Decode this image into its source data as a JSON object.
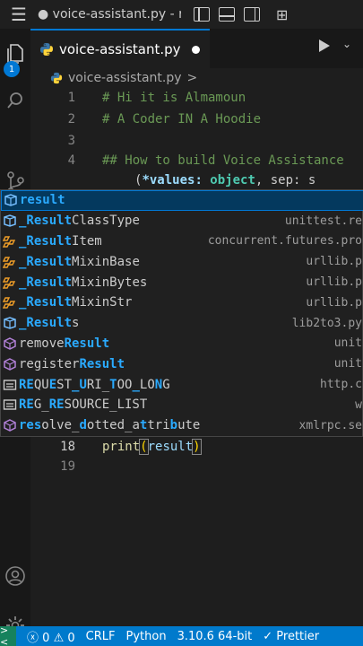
{
  "titlebar": {
    "title": "● voice-assistant.py - r"
  },
  "activity": {
    "explorer_badge": "1"
  },
  "tab": {
    "label": "voice-assistant.py"
  },
  "breadcrumb": {
    "file": "voice-assistant.py",
    "chevron": ">"
  },
  "editor": {
    "lines": [
      {
        "num": "1",
        "text": "# Hi it is Almamoun"
      },
      {
        "num": "2",
        "text": "# A Coder IN A Hoodie"
      },
      {
        "num": "3",
        "text": ""
      },
      {
        "num": "4",
        "text": "## How to build Voice Assistance"
      },
      {
        "num": "18",
        "fn": "print",
        "open": "(",
        "arg": "result",
        "close": ")"
      },
      {
        "num": "19",
        "text": ""
      }
    ],
    "signature": {
      "open": "(",
      "param1": "*values: ",
      "type1": "object",
      "rest": ", sep: s"
    }
  },
  "suggest": {
    "items": [
      {
        "pre": "",
        "match": "result",
        "post": "",
        "detail": "",
        "icon": "variable"
      },
      {
        "pre": "",
        "match": "_Result",
        "post": "ClassType",
        "detail": "unittest.re",
        "icon": "variable"
      },
      {
        "pre": "",
        "match": "_Result",
        "post": "Item",
        "detail": "concurrent.futures.pro",
        "icon": "class"
      },
      {
        "pre": "",
        "match": "_Result",
        "post": "MixinBase",
        "detail": "urllib.p",
        "icon": "class"
      },
      {
        "pre": "",
        "match": "_Result",
        "post": "MixinBytes",
        "detail": "urllib.p",
        "icon": "class"
      },
      {
        "pre": "",
        "match": "_Result",
        "post": "MixinStr",
        "detail": "urllib.p",
        "icon": "class"
      },
      {
        "pre": "",
        "match": "_Result",
        "post": "s",
        "detail": "lib2to3.py",
        "icon": "variable"
      },
      {
        "pre": "remove",
        "match": "Result",
        "post": "",
        "detail": "unit",
        "icon": "method"
      },
      {
        "pre": "register",
        "match": "Result",
        "post": "",
        "detail": "unit",
        "icon": "method"
      },
      {
        "pre": "",
        "match": "RE",
        "post": "QUE",
        "mid": "S",
        "post2": "T_",
        "m3": "U",
        "post3": "RI_TOO_",
        "m4": "L",
        "post4": "ONG",
        "detail": "http.c",
        "icon": "constant",
        "raw": "REQUEST_URI_TOO_LONG"
      },
      {
        "pre": "",
        "match": "RE",
        "post": "G_RE",
        "raw": "REG_RESOURCE_LIST",
        "detail": "w",
        "icon": "constant"
      },
      {
        "pre": "",
        "match": "res",
        "post": "olve_dotted_attribute",
        "raw": "resolve_dotted_attribute",
        "detail": "xmlrpc.se",
        "icon": "method"
      }
    ]
  },
  "status": {
    "errors": "0",
    "warnings": "0",
    "eol": "CRLF",
    "language": "Python",
    "interpreter": "3.10.6 64-bit",
    "formatter": "Prettier"
  }
}
